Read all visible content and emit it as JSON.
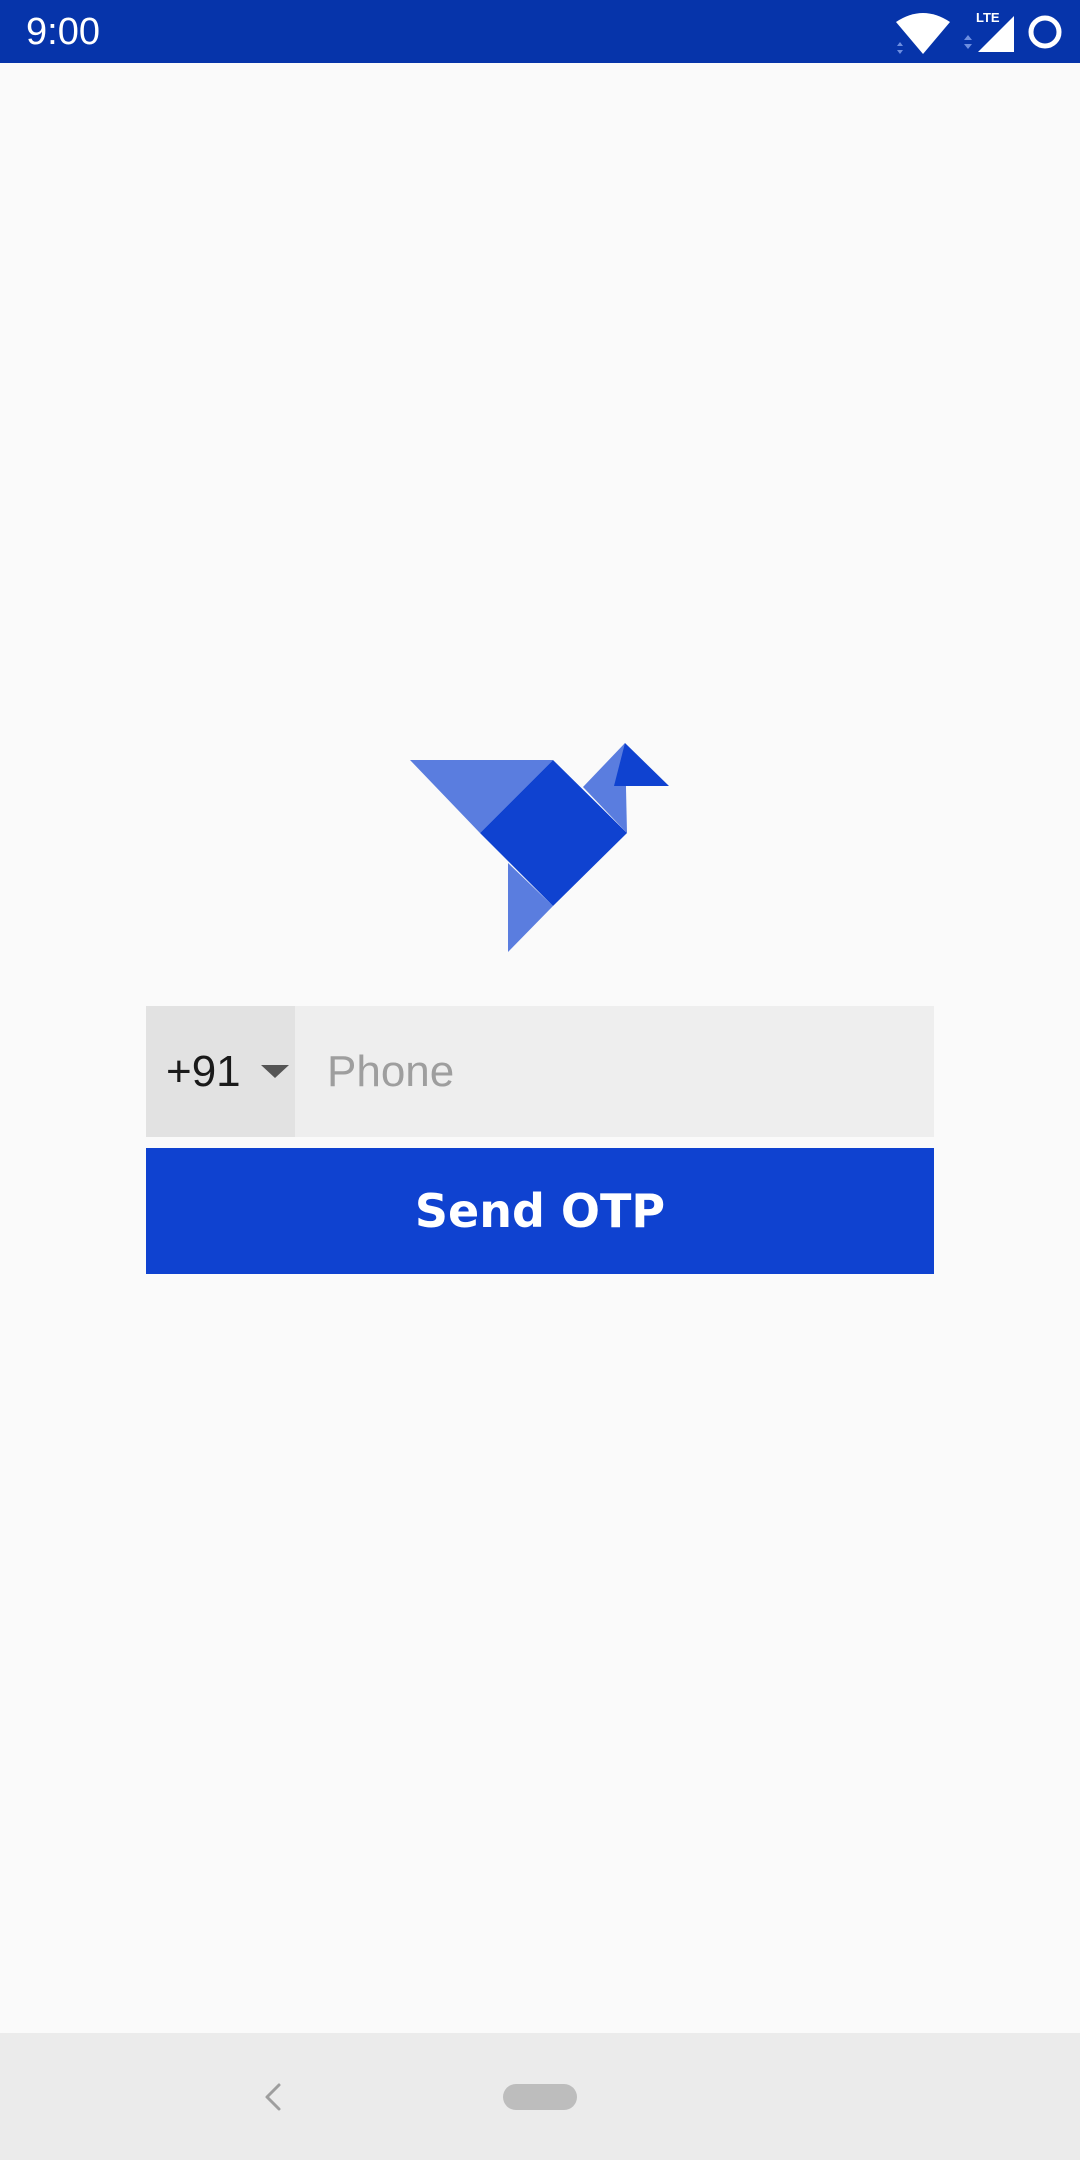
{
  "status_bar": {
    "time": "9:00",
    "network_label": "LTE",
    "background_color": "#0634aa",
    "icons": [
      "wifi-icon",
      "cellular-signal-icon",
      "circle-status-icon"
    ]
  },
  "logo": {
    "icon": "origami-bird-logo",
    "colors": {
      "light": "#5a7ddf",
      "dark": "#0f42d0"
    }
  },
  "login": {
    "country_code": "+91",
    "phone_placeholder": "Phone",
    "phone_value": "",
    "send_button_label": "Send OTP",
    "accent_color": "#0f42d0"
  },
  "nav_bar": {
    "icons": [
      "back-icon",
      "home-pill-icon"
    ]
  }
}
